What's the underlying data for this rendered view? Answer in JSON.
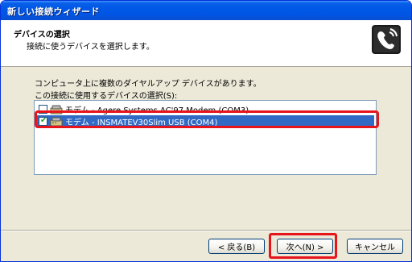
{
  "window": {
    "title": "新しい接続ウィザード"
  },
  "header": {
    "title": "デバイスの選択",
    "subtitle": "接続に使うデバイスを選択します。",
    "icon": "telephone-connection-icon"
  },
  "body": {
    "line1": "コンピュータ上に複数のダイヤルアップ デバイスがあります。",
    "line2": "この接続に使用するデバイスの選択(S):"
  },
  "devices": [
    {
      "label": "モデム - Agere Systems AC'97 Modem (COM3)",
      "checked": false,
      "selected": false
    },
    {
      "label": "モデム - INSMATEV30Slim USB (COM4)",
      "checked": true,
      "selected": true
    }
  ],
  "buttons": {
    "back": "< 戻る(B)",
    "next": "次へ(N) >",
    "cancel": "キャンセル"
  },
  "colors": {
    "highlight": "#e8141b",
    "selection": "#316ac5"
  }
}
